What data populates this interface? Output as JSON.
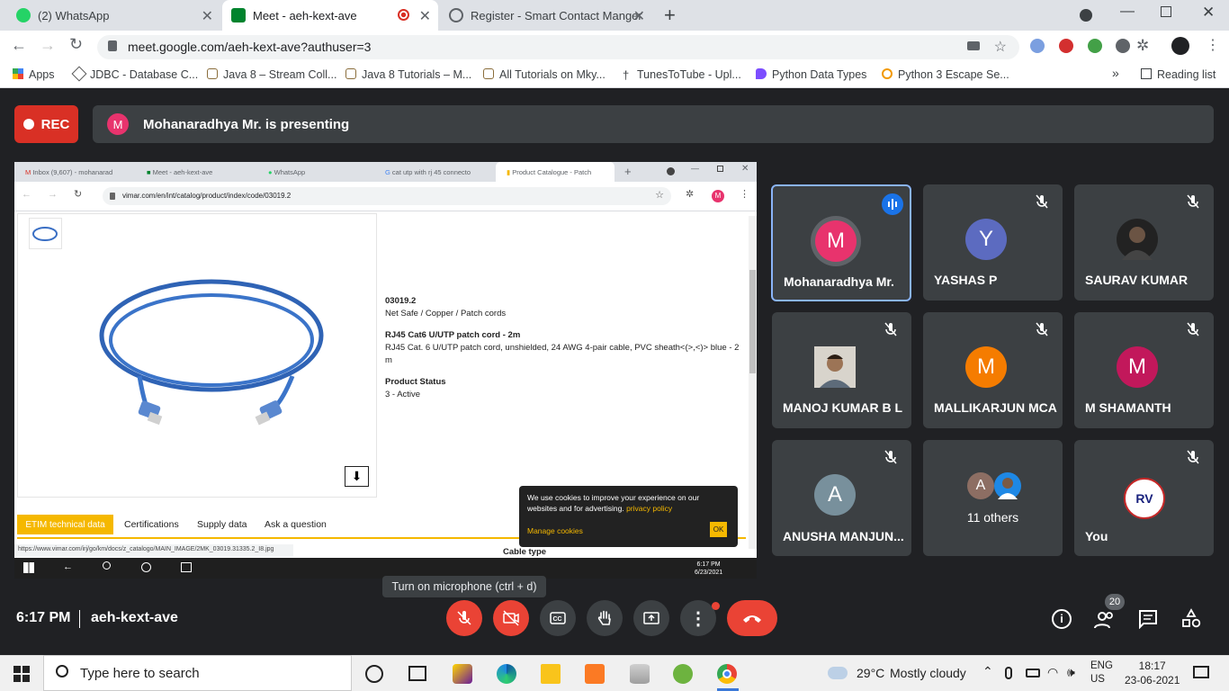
{
  "browser": {
    "tabs": [
      {
        "label": "(2) WhatsApp",
        "active": false
      },
      {
        "label": "Meet - aeh-kext-ave",
        "active": true
      },
      {
        "label": "Register - Smart Contact Manger",
        "active": false
      }
    ],
    "url": "meet.google.com/aeh-kext-ave?authuser=3",
    "bookmarks": [
      "Apps",
      "JDBC - Database C...",
      "Java 8 – Stream Coll...",
      "Java 8 Tutorials – M...",
      "All Tutorials on Mky...",
      "TunesToTube - Upl...",
      "Python Data Types",
      "Python 3 Escape Se..."
    ],
    "reading_list": "Reading list",
    "more_bookmarks": "»"
  },
  "meet": {
    "rec_label": "REC",
    "presenter_initial": "M",
    "presenting_text": "Mohanaradhya Mr. is presenting",
    "tooltip": "Turn on microphone (ctrl + d)",
    "time": "6:17 PM",
    "meeting_code": "aeh-kext-ave",
    "participant_count": "20",
    "participants": [
      {
        "name": "Mohanaradhya Mr.",
        "initial": "M",
        "color": "#e8336d",
        "speaking": true
      },
      {
        "name": "YASHAS P",
        "initial": "Y",
        "color": "#5c6bc0",
        "speaking": false
      },
      {
        "name": "SAURAV KUMAR",
        "initial": "",
        "color": "#222222",
        "speaking": false
      },
      {
        "name": "MANOJ KUMAR B L",
        "initial": "",
        "color": "#7a6a5a",
        "speaking": false
      },
      {
        "name": "MALLIKARJUN MCA",
        "initial": "M",
        "color": "#f57c00",
        "speaking": false
      },
      {
        "name": "M SHAMANTH",
        "initial": "M",
        "color": "#c2185b",
        "speaking": false
      },
      {
        "name": "ANUSHA MANJUN...",
        "initial": "A",
        "color": "#78909c",
        "speaking": false
      },
      {
        "name": "11 others",
        "initial": "A",
        "color": "#8d6e63",
        "speaking": false
      },
      {
        "name": "You",
        "initial": "RV",
        "color": "#ffffff",
        "speaking": false
      }
    ]
  },
  "shared": {
    "tabs": [
      "Inbox (9,607) - mohanarad",
      "Meet - aeh-kext-ave",
      "WhatsApp",
      "cat utp with rj 45 connecto",
      "Product Catalogue - Patch"
    ],
    "url": "vimar.com/en/int/catalog/product/index/code/03019.2",
    "product_code": "03019.2",
    "category": "Net Safe / Copper / Patch cords",
    "product_title": "RJ45 Cat6 U/UTP patch cord - 2m",
    "description": "RJ45 Cat. 6 U/UTP patch cord, unshielded, 24 AWG 4-pair cable, PVC sheath<(>,<)> blue - 2 m",
    "status_label": "Product Status",
    "status_value": "3 - Active",
    "page_tabs": [
      "ETIM technical data",
      "Certifications",
      "Supply data",
      "Ask a question"
    ],
    "cookie_text": "We use cookies to improve your experience on our websites and for advertising.",
    "cookie_link": "privacy policy",
    "manage_cookies": "Manage cookies",
    "ok": "OK",
    "cable_type": "Cable type",
    "status_url": "https://www.vimar.com/irj/go/km/docs/z_catalogo/MAIN_IMAGE/2MK_03019.31335.2_I8.jpg",
    "taskbar_time": "6:17 PM",
    "taskbar_date": "6/23/2021"
  },
  "windows": {
    "search_placeholder": "Type here to search",
    "temperature": "29°C",
    "weather": "Mostly cloudy",
    "lang1": "ENG",
    "lang2": "US",
    "time": "18:17",
    "date": "23-06-2021"
  }
}
